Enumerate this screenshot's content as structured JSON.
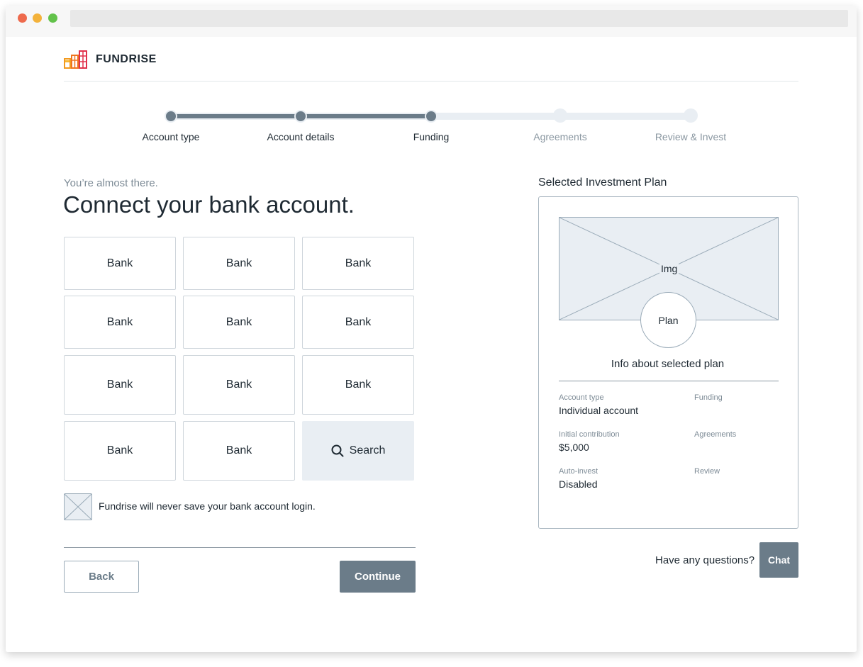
{
  "brand": {
    "name": "FUNDRISE"
  },
  "steps": [
    {
      "label": "Account type",
      "done": true
    },
    {
      "label": "Account details",
      "done": true
    },
    {
      "label": "Funding",
      "done": true
    },
    {
      "label": "Agreements",
      "done": false
    },
    {
      "label": "Review & Invest",
      "done": false
    }
  ],
  "progress": {
    "completed_steps": 3,
    "total_steps": 5
  },
  "main": {
    "eyebrow": "You’re almost there.",
    "headline": "Connect your bank account.",
    "banks": [
      "Bank",
      "Bank",
      "Bank",
      "Bank",
      "Bank",
      "Bank",
      "Bank",
      "Bank",
      "Bank",
      "Bank",
      "Bank"
    ],
    "search_label": "Search",
    "notice": "Fundrise will never save your bank account login.",
    "back_label": "Back",
    "continue_label": "Continue"
  },
  "panel": {
    "title": "Selected Investment Plan",
    "img_label": "Img",
    "plan_label": "Plan",
    "info": "Info about selected plan",
    "fields": {
      "account_type_label": "Account type",
      "account_type_value": "Individual account",
      "funding_label": "Funding",
      "initial_contribution_label": "Initial contribution",
      "initial_contribution_value": "$5,000",
      "agreements_label": "Agreements",
      "auto_invest_label": "Auto-invest",
      "auto_invest_value": "Disabled",
      "review_label": "Review"
    }
  },
  "help": {
    "questions": "Have any questions?",
    "chat_label": "Chat"
  },
  "colors": {
    "accent": "#6b7c89",
    "track": "#e9eef3",
    "logo_orange": "#f29a1f",
    "logo_red": "#e0314b"
  }
}
